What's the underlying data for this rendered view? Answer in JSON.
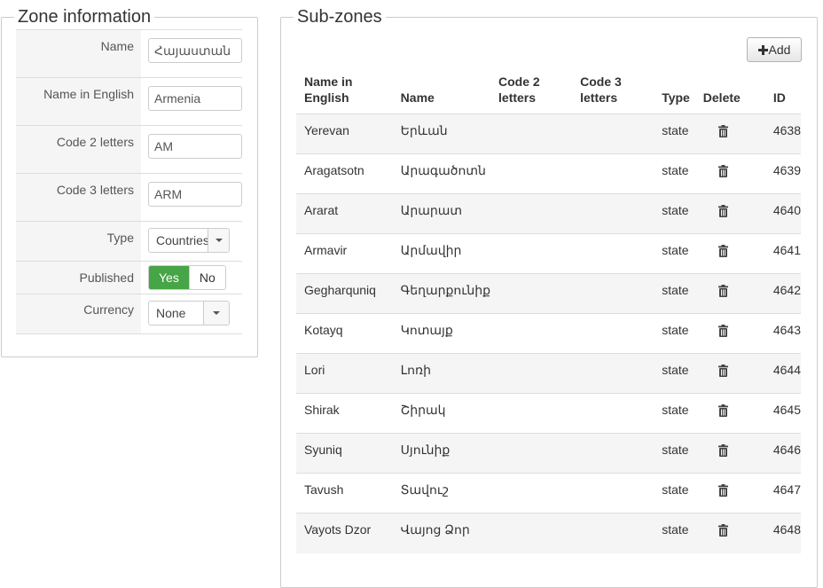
{
  "zone": {
    "legend": "Zone information",
    "fields": {
      "name": {
        "label": "Name",
        "value": "Հայաստան"
      },
      "name_en": {
        "label": "Name in English",
        "value": "Armenia"
      },
      "code2": {
        "label": "Code 2 letters",
        "value": "AM"
      },
      "code3": {
        "label": "Code 3 letters",
        "value": "ARM"
      },
      "type": {
        "label": "Type",
        "value": "Countries"
      },
      "published": {
        "label": "Published",
        "yes": "Yes",
        "no": "No",
        "selected": "Yes"
      },
      "currency": {
        "label": "Currency",
        "value": "None"
      }
    }
  },
  "subzones": {
    "legend": "Sub-zones",
    "add_label": "Add",
    "headers": {
      "name_en_line1": "Name in",
      "name_en_line2": "English",
      "name": "Name",
      "code2_line1": "Code 2",
      "code2_line2": "letters",
      "code3_line1": "Code 3",
      "code3_line2": "letters",
      "type": "Type",
      "delete": "Delete",
      "id": "ID"
    },
    "rows": [
      {
        "name_en": "Yerevan",
        "name": "Երևան",
        "code2": "",
        "code3": "",
        "type": "state",
        "id": "4638"
      },
      {
        "name_en": "Aragatsotn",
        "name": "Արագածոտն",
        "code2": "",
        "code3": "",
        "type": "state",
        "id": "4639"
      },
      {
        "name_en": "Ararat",
        "name": "Արարատ",
        "code2": "",
        "code3": "",
        "type": "state",
        "id": "4640"
      },
      {
        "name_en": "Armavir",
        "name": "Արմավիր",
        "code2": "",
        "code3": "",
        "type": "state",
        "id": "4641"
      },
      {
        "name_en": "Gegharquniq",
        "name": "Գեղարքունիք",
        "code2": "",
        "code3": "",
        "type": "state",
        "id": "4642"
      },
      {
        "name_en": "Kotayq",
        "name": "Կոտայք",
        "code2": "",
        "code3": "",
        "type": "state",
        "id": "4643"
      },
      {
        "name_en": "Lori",
        "name": "Լոռի",
        "code2": "",
        "code3": "",
        "type": "state",
        "id": "4644"
      },
      {
        "name_en": "Shirak",
        "name": "Շիրակ",
        "code2": "",
        "code3": "",
        "type": "state",
        "id": "4645"
      },
      {
        "name_en": "Syuniq",
        "name": "Սյունիք",
        "code2": "",
        "code3": "",
        "type": "state",
        "id": "4646"
      },
      {
        "name_en": "Tavush",
        "name": "Տավուշ",
        "code2": "",
        "code3": "",
        "type": "state",
        "id": "4647"
      },
      {
        "name_en": "Vayots Dzor",
        "name": "Վայոց Ձոր",
        "code2": "",
        "code3": "",
        "type": "state",
        "id": "4648"
      }
    ]
  },
  "icons": {
    "add": "plus-icon",
    "delete": "trash-icon",
    "select": "chevron-down-icon"
  },
  "colors": {
    "published_on": "#46a546",
    "row_stripe": "#f5f5f5"
  }
}
